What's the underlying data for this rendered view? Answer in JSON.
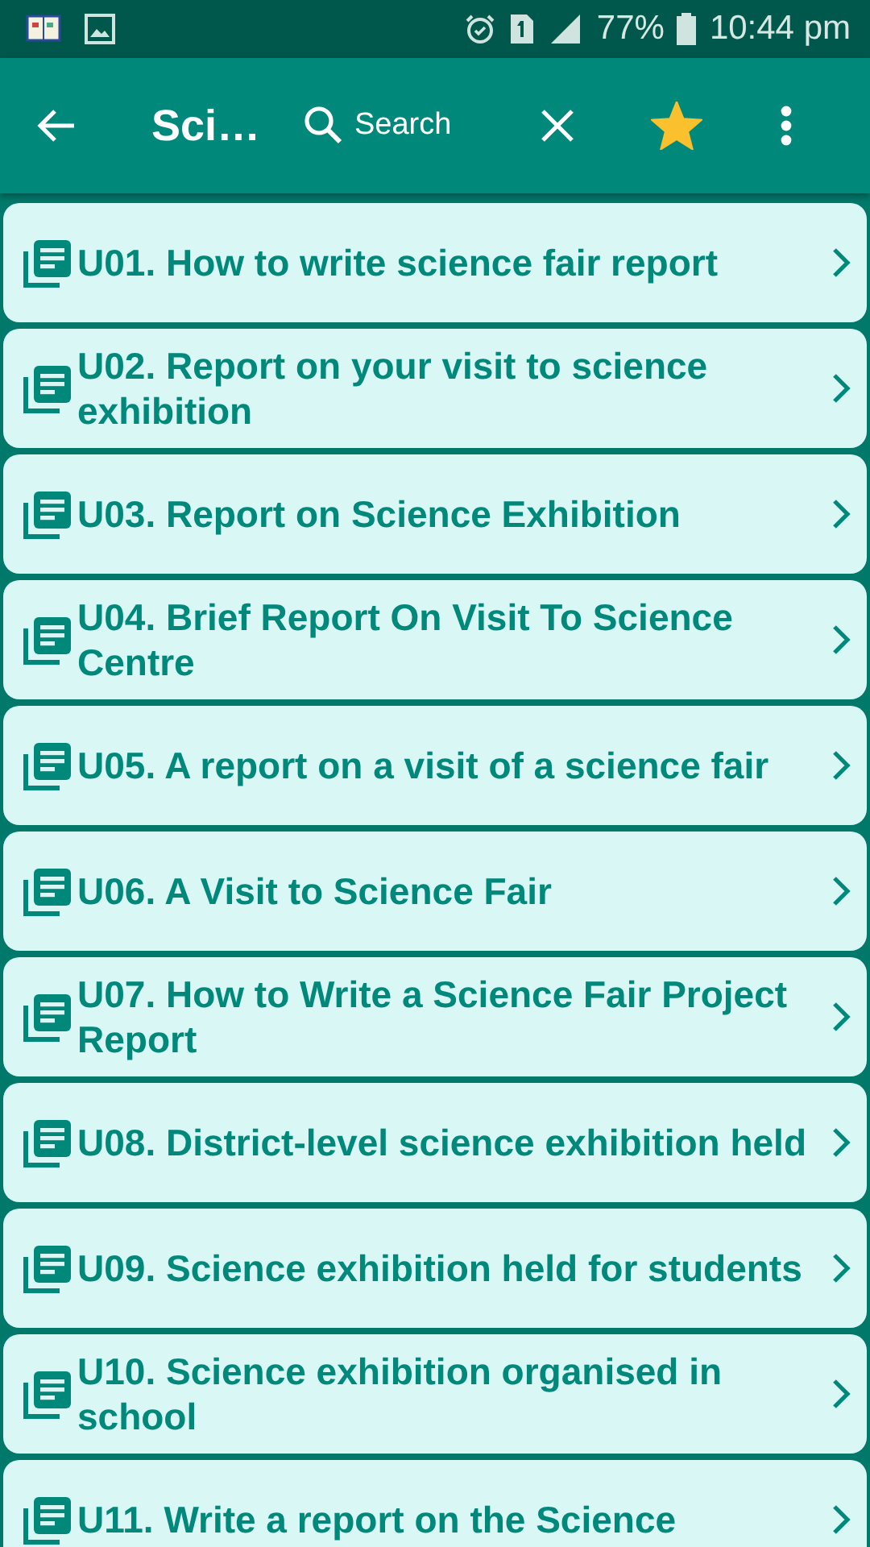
{
  "status_bar": {
    "battery": "77%",
    "time": "10:44 pm"
  },
  "app_bar": {
    "title": "Sci…",
    "search": {
      "placeholder": "Search"
    },
    "favorite": true
  },
  "items": [
    {
      "title": "U01. How to write science fair report"
    },
    {
      "title": "U02. Report on your visit to science exhibition"
    },
    {
      "title": "U03. Report on Science Exhibition"
    },
    {
      "title": "U04. Brief Report On Visit To Science Centre"
    },
    {
      "title": "U05. A report on a visit of a science fair"
    },
    {
      "title": "U06. A Visit to Science Fair"
    },
    {
      "title": "U07. How to Write a Science Fair Project Report"
    },
    {
      "title": "U08. District-level science exhibition held"
    },
    {
      "title": "U09. Science exhibition held for students"
    },
    {
      "title": "U10. Science exhibition organised in school"
    },
    {
      "title": "U11. Write a report on the Science"
    }
  ]
}
